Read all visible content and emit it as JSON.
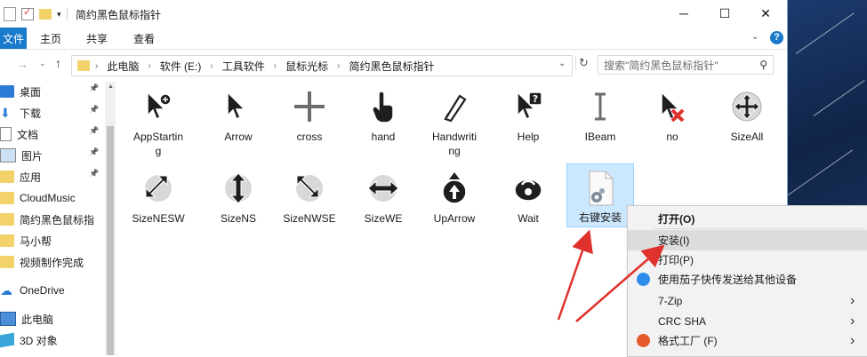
{
  "window": {
    "title": "简约黑色鼠标指针",
    "accent": "#1979ca",
    "controls": {
      "minimize": "─",
      "maximize": "☐",
      "close": "✕"
    }
  },
  "ribbon": {
    "file_tab": "文件",
    "tabs": [
      "主页",
      "共享",
      "查看"
    ]
  },
  "address": {
    "crumbs": [
      "此电脑",
      "软件 (E:)",
      "工具软件",
      "鼠标光标",
      "简约黑色鼠标指针"
    ],
    "search_placeholder": "搜索\"简约黑色鼠标指针\""
  },
  "nav": {
    "items": [
      {
        "label": "桌面",
        "icon": "desktop-icon",
        "pinned": true
      },
      {
        "label": "下载",
        "icon": "download-arrow-icon",
        "pinned": true
      },
      {
        "label": "文档",
        "icon": "document-icon",
        "pinned": true
      },
      {
        "label": "图片",
        "icon": "pictures-icon",
        "pinned": true
      },
      {
        "label": "应用",
        "icon": "folder-icon",
        "pinned": true
      },
      {
        "label": "CloudMusic",
        "icon": "folder-icon",
        "pinned": false
      },
      {
        "label": "简约黑色鼠标指",
        "icon": "folder-icon",
        "pinned": false
      },
      {
        "label": "马小帮",
        "icon": "folder-icon",
        "pinned": false
      },
      {
        "label": "视频制作完成",
        "icon": "folder-icon",
        "pinned": false
      },
      {
        "label": "OneDrive",
        "icon": "cloud-icon",
        "pinned": false
      },
      {
        "label": "此电脑",
        "icon": "computer-icon",
        "pinned": false
      },
      {
        "label": "3D 对象",
        "icon": "cube-3d-icon",
        "pinned": false
      }
    ]
  },
  "files": [
    {
      "label": "AppStartin\ng",
      "icon": "cursor-appstarting-icon"
    },
    {
      "label": "Arrow",
      "icon": "cursor-arrow-icon"
    },
    {
      "label": "cross",
      "icon": "cursor-cross-icon"
    },
    {
      "label": "hand",
      "icon": "cursor-hand-icon"
    },
    {
      "label": "Handwriti\nng",
      "icon": "cursor-handwriting-icon"
    },
    {
      "label": "Help",
      "icon": "cursor-help-icon"
    },
    {
      "label": "IBeam",
      "icon": "cursor-ibeam-icon"
    },
    {
      "label": "no",
      "icon": "cursor-no-icon"
    },
    {
      "label": "SizeAll",
      "icon": "cursor-sizeall-icon"
    },
    {
      "label": "SizeNESW",
      "icon": "cursor-sizenesw-icon"
    },
    {
      "label": "SizeNS",
      "icon": "cursor-sizens-icon"
    },
    {
      "label": "SizeNWSE",
      "icon": "cursor-sizenwse-icon"
    },
    {
      "label": "SizeWE",
      "icon": "cursor-sizewe-icon"
    },
    {
      "label": "UpArrow",
      "icon": "cursor-uparrow-icon"
    },
    {
      "label": "Wait",
      "icon": "cursor-wait-icon"
    },
    {
      "label": "右键安装",
      "icon": "inf-settings-file-icon",
      "selected": true
    }
  ],
  "context_menu": {
    "items": [
      {
        "label": "打开(O)",
        "bold": true
      },
      {
        "label": "安装(I)",
        "highlighted": true
      },
      {
        "label": "打印(P)"
      },
      {
        "label": "使用茄子快传发送给其他设备",
        "icon": "send-app-icon"
      },
      {
        "label": "7-Zip",
        "submenu": true
      },
      {
        "label": "CRC SHA",
        "submenu": true
      },
      {
        "label": "格式工厂 (F)",
        "icon": "format-factory-icon",
        "submenu": true
      }
    ]
  },
  "annotation_color": "#e0322d"
}
